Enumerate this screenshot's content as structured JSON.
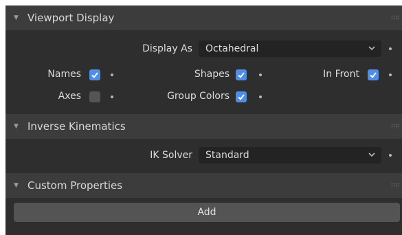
{
  "viewport_display": {
    "title": "Viewport Display",
    "display_as_label": "Display As",
    "display_as_value": "Octahedral",
    "names_label": "Names",
    "names_checked": true,
    "shapes_label": "Shapes",
    "shapes_checked": true,
    "in_front_label": "In Front",
    "in_front_checked": true,
    "axes_label": "Axes",
    "axes_checked": false,
    "group_colors_label": "Group Colors",
    "group_colors_checked": true
  },
  "inverse_kinematics": {
    "title": "Inverse Kinematics",
    "ik_solver_label": "IK Solver",
    "ik_solver_value": "Standard"
  },
  "custom_properties": {
    "title": "Custom Properties",
    "add_label": "Add"
  },
  "colors": {
    "accent": "#4f8ee6",
    "panel_header": "#3c3c3c",
    "panel_body": "#2e2e2e",
    "dropdown_bg": "#232323",
    "button_bg": "#545454"
  }
}
